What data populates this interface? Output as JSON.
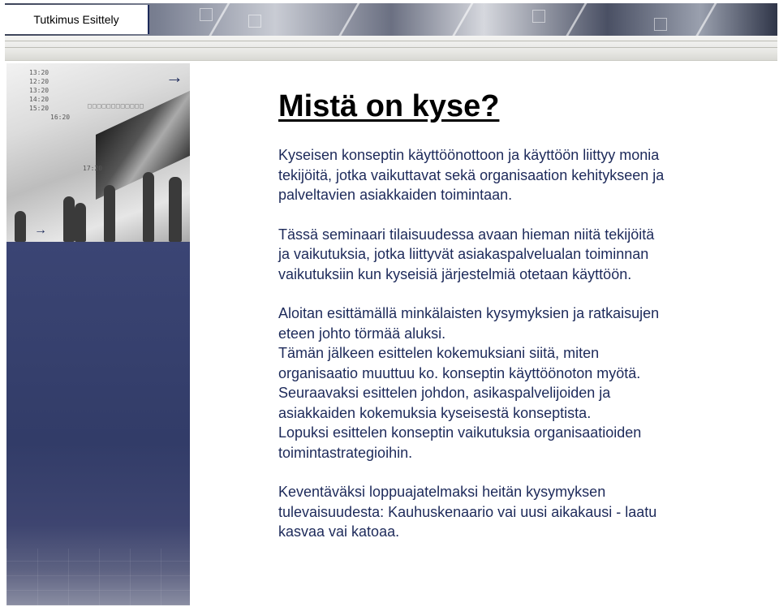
{
  "header": {
    "title": "Tutkimus Esittely"
  },
  "photo": {
    "times": [
      "13:20",
      "12:20",
      "13:20",
      "14:20",
      "15:20",
      "16:20",
      "17:20"
    ],
    "arrow_icon": "arrow-right-icon"
  },
  "main": {
    "heading": "Mistä on kyse?",
    "p1": "Kyseisen konseptin käyttöönottoon ja käyttöön liittyy monia\ntekijöitä, jotka vaikuttavat sekä organisaation kehitykseen ja\npalveltavien asiakkaiden toimintaan.",
    "p2": "Tässä seminaari tilaisuudessa avaan hieman niitä tekijöitä\nja vaikutuksia, jotka liittyvät asiakaspalvelualan toiminnan\nvaikutuksiin kun kyseisiä järjestelmiä otetaan käyttöön.",
    "p3": "Aloitan esittämällä minkälaisten kysymyksien ja ratkaisujen\neteen johto törmää aluksi.\nTämän jälkeen esittelen kokemuksiani siitä, miten\norganisaatio muuttuu ko. konseptin käyttöönoton myötä.\nSeuraavaksi esittelen johdon, asikaspalvelijoiden ja\nasiakkaiden kokemuksia kyseisestä konseptista.\nLopuksi esittelen konseptin vaikutuksia organisaatioiden\ntoimintastrategioihin.",
    "p4": "Keventäväksi loppuajatelmaksi heitän kysymyksen\ntulevaisuudesta: Kauhuskenaario vai uusi aikakausi - laatu\nkasvaa vai katoaa."
  },
  "colors": {
    "text": "#1d2a5a",
    "heading": "#000000",
    "navy_panel": "#343e6a"
  }
}
